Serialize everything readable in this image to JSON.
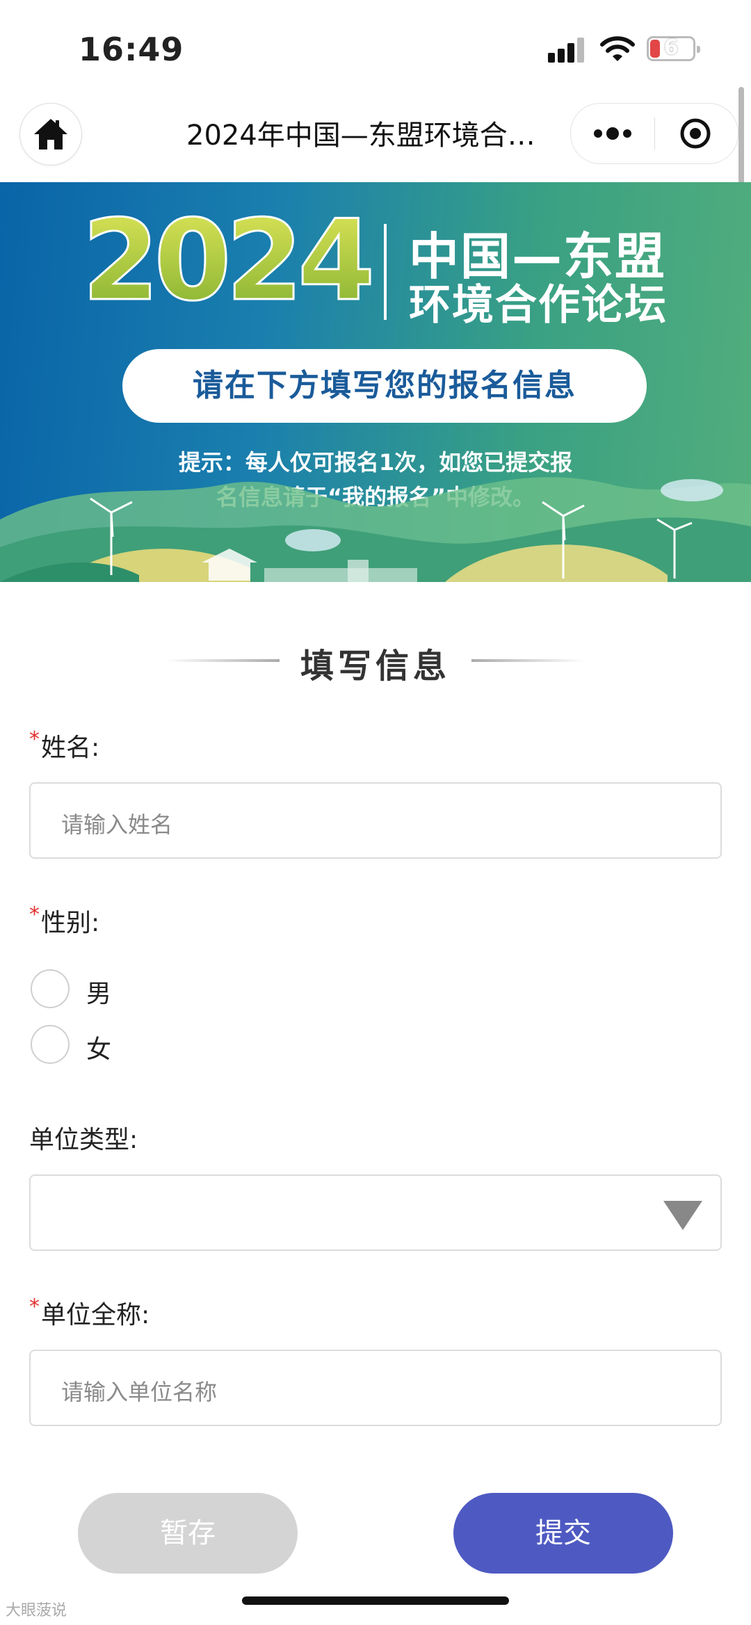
{
  "status_bar": {
    "time": "16:49",
    "battery": "6"
  },
  "nav": {
    "title": "2024年中国—东盟环境合…"
  },
  "banner": {
    "year": "2024",
    "title_line1": "中国—东盟",
    "title_line2": "环境合作论坛",
    "pill_text": "请在下方填写您的报名信息",
    "tip_line1": "提示：每人仅可报名1次，如您已提交报",
    "tip_line2": "名信息请于“我的报名”中修改。"
  },
  "form": {
    "section_title": "填写信息",
    "name": {
      "label": "姓名:",
      "placeholder": "请输入姓名"
    },
    "gender": {
      "label": "性别:",
      "options": [
        "男",
        "女"
      ]
    },
    "org_type": {
      "label": "单位类型:",
      "value": ""
    },
    "org_name": {
      "label": "单位全称:",
      "placeholder": "请输入单位名称"
    },
    "required_mark": "*"
  },
  "buttons": {
    "save": "暂存",
    "submit": "提交"
  },
  "watermark": "大眼菠说",
  "colors": {
    "submit": "#4e5ac2",
    "save_disabled": "#d4d4d4",
    "required": "#e23030"
  }
}
